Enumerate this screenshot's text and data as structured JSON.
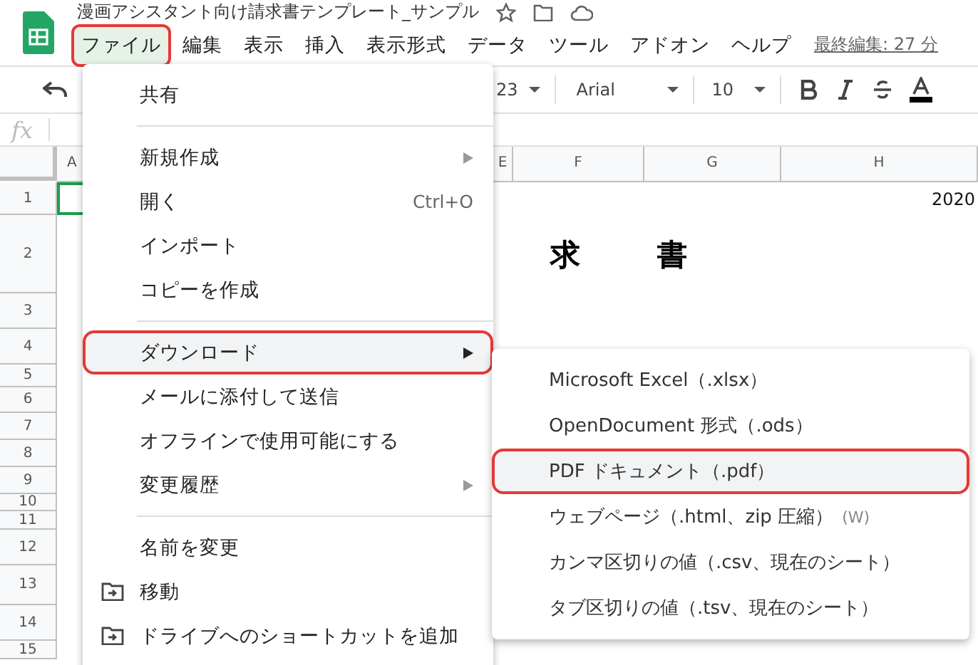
{
  "document": {
    "title": "漫画アシスタント向け請求書テンプレート_サンプル",
    "last_edit": "最終編集: 27 分"
  },
  "menubar": [
    {
      "label": "ファイル",
      "selected": true,
      "highlighted": true
    },
    {
      "label": "編集",
      "selected": false,
      "highlighted": false
    },
    {
      "label": "表示",
      "selected": false,
      "highlighted": false
    },
    {
      "label": "挿入",
      "selected": false,
      "highlighted": false
    },
    {
      "label": "表示形式",
      "selected": false,
      "highlighted": false
    },
    {
      "label": "データ",
      "selected": false,
      "highlighted": false
    },
    {
      "label": "ツール",
      "selected": false,
      "highlighted": false
    },
    {
      "label": "アドオン",
      "selected": false,
      "highlighted": false
    },
    {
      "label": "ヘルプ",
      "selected": false,
      "highlighted": false
    }
  ],
  "toolbar": {
    "number_format": "23",
    "font": "Arial",
    "font_size": "10"
  },
  "formula_bar": {
    "label": "fx"
  },
  "sheet": {
    "columns": [
      {
        "label": "A"
      },
      {
        "label": "E"
      },
      {
        "label": "F"
      },
      {
        "label": "G"
      },
      {
        "label": "H"
      }
    ],
    "rows": [
      "1",
      "2",
      "3",
      "4",
      "5",
      "6",
      "7",
      "8",
      "9",
      "10",
      "11",
      "12",
      "13",
      "14",
      "15"
    ],
    "date_cell": "2020",
    "heading_cell": "求　　書"
  },
  "file_menu": [
    {
      "kind": "item",
      "label": "共有",
      "submenu": false,
      "highlighted": false,
      "icon": false
    },
    {
      "kind": "separator"
    },
    {
      "kind": "item",
      "label": "新規作成",
      "submenu": true,
      "highlighted": false,
      "icon": false
    },
    {
      "kind": "item",
      "label": "開く",
      "shortcut": "Ctrl+O",
      "submenu": false,
      "highlighted": false,
      "icon": false
    },
    {
      "kind": "item",
      "label": "インポート",
      "submenu": false,
      "highlighted": false,
      "icon": false
    },
    {
      "kind": "item",
      "label": "コピーを作成",
      "submenu": false,
      "highlighted": false,
      "icon": false
    },
    {
      "kind": "separator"
    },
    {
      "kind": "item",
      "label": "ダウンロード",
      "submenu": true,
      "highlighted": true,
      "icon": false
    },
    {
      "kind": "item",
      "label": "メールに添付して送信",
      "submenu": false,
      "highlighted": false,
      "icon": false
    },
    {
      "kind": "item",
      "label": "オフラインで使用可能にする",
      "submenu": false,
      "highlighted": false,
      "icon": false
    },
    {
      "kind": "item",
      "label": "変更履歴",
      "submenu": true,
      "highlighted": false,
      "icon": false
    },
    {
      "kind": "separator"
    },
    {
      "kind": "item",
      "label": "名前を変更",
      "submenu": false,
      "highlighted": false,
      "icon": false
    },
    {
      "kind": "item",
      "label": "移動",
      "submenu": false,
      "highlighted": false,
      "icon": true
    },
    {
      "kind": "item",
      "label": "ドライブへのショートカットを追加",
      "submenu": false,
      "highlighted": false,
      "icon": true
    }
  ],
  "download_menu": [
    {
      "label": "Microsoft Excel（.xlsx）",
      "highlighted": false
    },
    {
      "label": "OpenDocument 形式（.ods）",
      "highlighted": false
    },
    {
      "label": "PDF ドキュメント（.pdf）",
      "highlighted": true
    },
    {
      "label": "ウェブページ（.html、zip 圧縮）",
      "hint": "(W)",
      "highlighted": false
    },
    {
      "label": "カンマ区切りの値（.csv、現在のシート）",
      "highlighted": false
    },
    {
      "label": "タブ区切りの値（.tsv、現在のシート）",
      "highlighted": false
    }
  ]
}
